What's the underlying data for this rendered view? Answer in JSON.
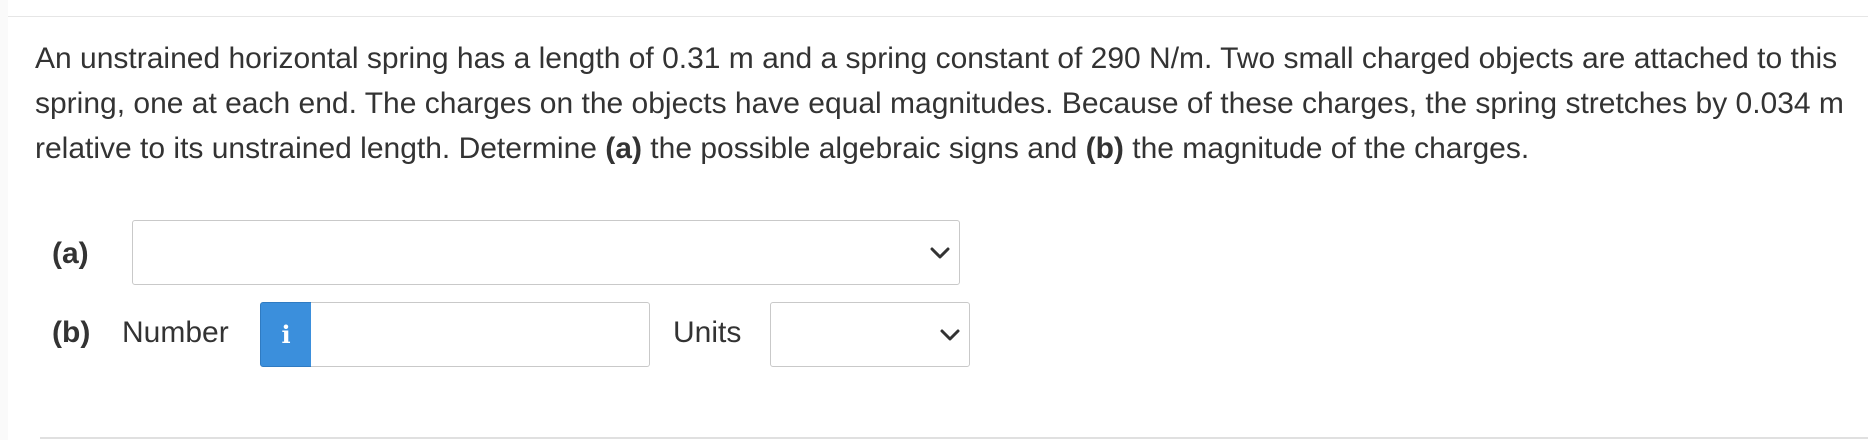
{
  "question": {
    "part1": "An unstrained horizontal spring has a length of 0.31 m and a spring constant of 290 N/m. Two small charged objects are attached to this spring, one at each end. The charges on the objects have equal magnitudes. Because of these charges, the spring stretches by 0.034 m relative to its unstrained length. Determine ",
    "bold_a": "(a)",
    "part2": " the possible algebraic signs and ",
    "bold_b": "(b)",
    "part3": " the magnitude of the charges."
  },
  "part_a": {
    "label": "(a)",
    "selected_value": "",
    "icon": "chevron-down-icon"
  },
  "part_b": {
    "label": "(b)",
    "number_label": "Number",
    "info_icon_text": "i",
    "number_value": "",
    "units_label": "Units",
    "units_selected_value": "",
    "icon": "chevron-down-icon"
  },
  "colors": {
    "info_button": "#3b8fdc",
    "text": "#333333",
    "border": "#c9c9c9"
  }
}
